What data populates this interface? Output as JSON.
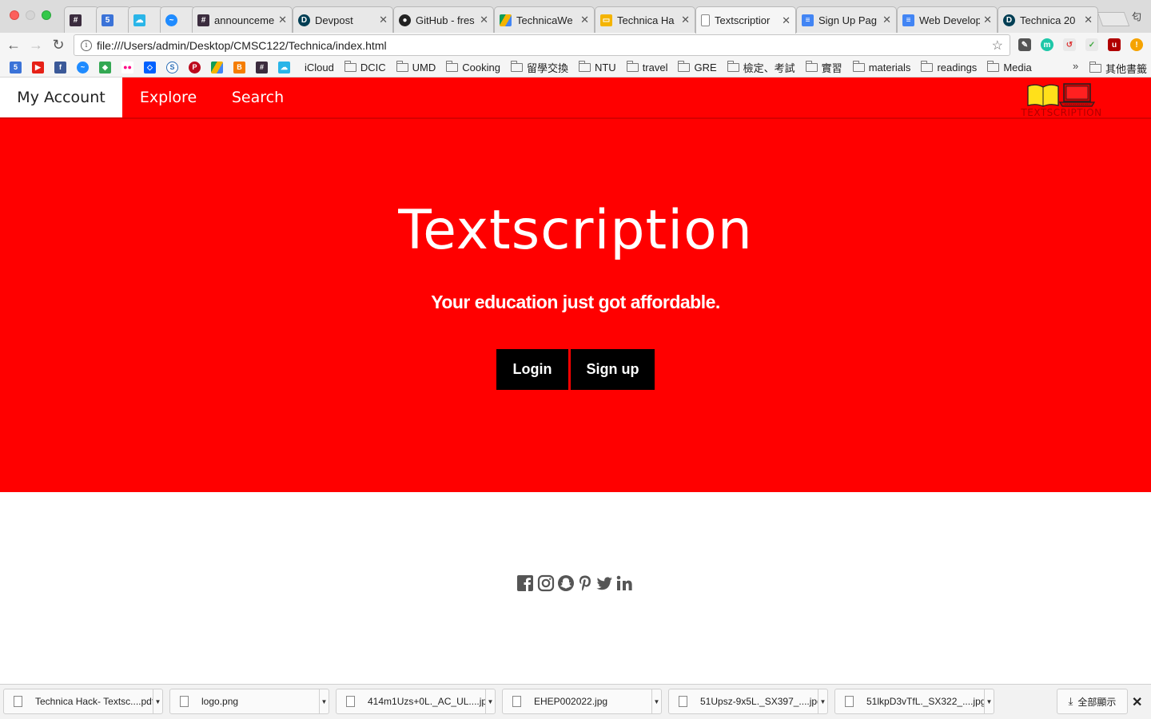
{
  "browser": {
    "tabs": [
      {
        "title": "#",
        "icon": "slack-icon",
        "color": "#3b2c3e"
      },
      {
        "title": "5",
        "icon": "calendar-icon",
        "color": "#3b73d8"
      },
      {
        "title": "",
        "icon": "cloud-icon",
        "color": "#2ab5e8"
      },
      {
        "title": "",
        "icon": "messenger-icon",
        "color": "#1f8bff"
      },
      {
        "title": "announceme",
        "icon": "slack-icon",
        "color": "#3b2c3e"
      },
      {
        "title": "Devpost",
        "icon": "devpost-icon",
        "color": "#003e54"
      },
      {
        "title": "GitHub - fres",
        "icon": "github-icon",
        "color": "#222222"
      },
      {
        "title": "TechnicaWe",
        "icon": "drive-icon",
        "color": "#f4b400"
      },
      {
        "title": "Technica Ha",
        "icon": "slides-icon",
        "color": "#f4b400"
      },
      {
        "title": "Textscriptior",
        "icon": "page-icon",
        "color": "#888888"
      },
      {
        "title": "Sign Up Pag",
        "icon": "docs-icon",
        "color": "#4285f4"
      },
      {
        "title": "Web Develop",
        "icon": "docs-icon",
        "color": "#4285f4"
      },
      {
        "title": "Technica 20",
        "icon": "devpost-icon",
        "color": "#003e54"
      }
    ],
    "active_tab_index": 9,
    "profile_glyph": "匂",
    "url": "file:///Users/admin/Desktop/CMSC122/Technica/index.html",
    "bookmarks": [
      {
        "label": "iCloud",
        "type": "apple"
      },
      {
        "label": "DCIC",
        "type": "folder"
      },
      {
        "label": "UMD",
        "type": "folder"
      },
      {
        "label": "Cooking",
        "type": "folder"
      },
      {
        "label": "留學交換",
        "type": "folder"
      },
      {
        "label": "NTU",
        "type": "folder"
      },
      {
        "label": "travel",
        "type": "folder"
      },
      {
        "label": "GRE",
        "type": "folder"
      },
      {
        "label": "檢定、考試",
        "type": "folder"
      },
      {
        "label": "實習",
        "type": "folder"
      },
      {
        "label": "materials",
        "type": "folder"
      },
      {
        "label": "readings",
        "type": "folder"
      },
      {
        "label": "Media",
        "type": "folder"
      }
    ],
    "bookmark_more": "»",
    "bookmark_other": "其他書籤",
    "downloads": [
      "Technica Hack- Textsc....pdf",
      "logo.png",
      "414m1Uzs+0L._AC_UL....jpg",
      "EHEP002022.jpg",
      "51Upsz-9x5L._SX397_....jpg",
      "51lkpD3vTfL._SX322_....jpg"
    ],
    "show_all": "全部顯示"
  },
  "site": {
    "nav": [
      "My Account",
      "Explore",
      "Search"
    ],
    "logo_text": "TEXTSCRIPTION",
    "hero_title": "Textscription",
    "hero_subtitle": "Your education just got affordable.",
    "login_label": "Login",
    "signup_label": "Sign up",
    "social": [
      "facebook-icon",
      "instagram-icon",
      "snapchat-icon",
      "pinterest-icon",
      "twitter-icon",
      "linkedin-icon"
    ],
    "colors": {
      "brand_red": "#ff0000",
      "button_black": "#000000",
      "social_grey": "#555555"
    }
  }
}
